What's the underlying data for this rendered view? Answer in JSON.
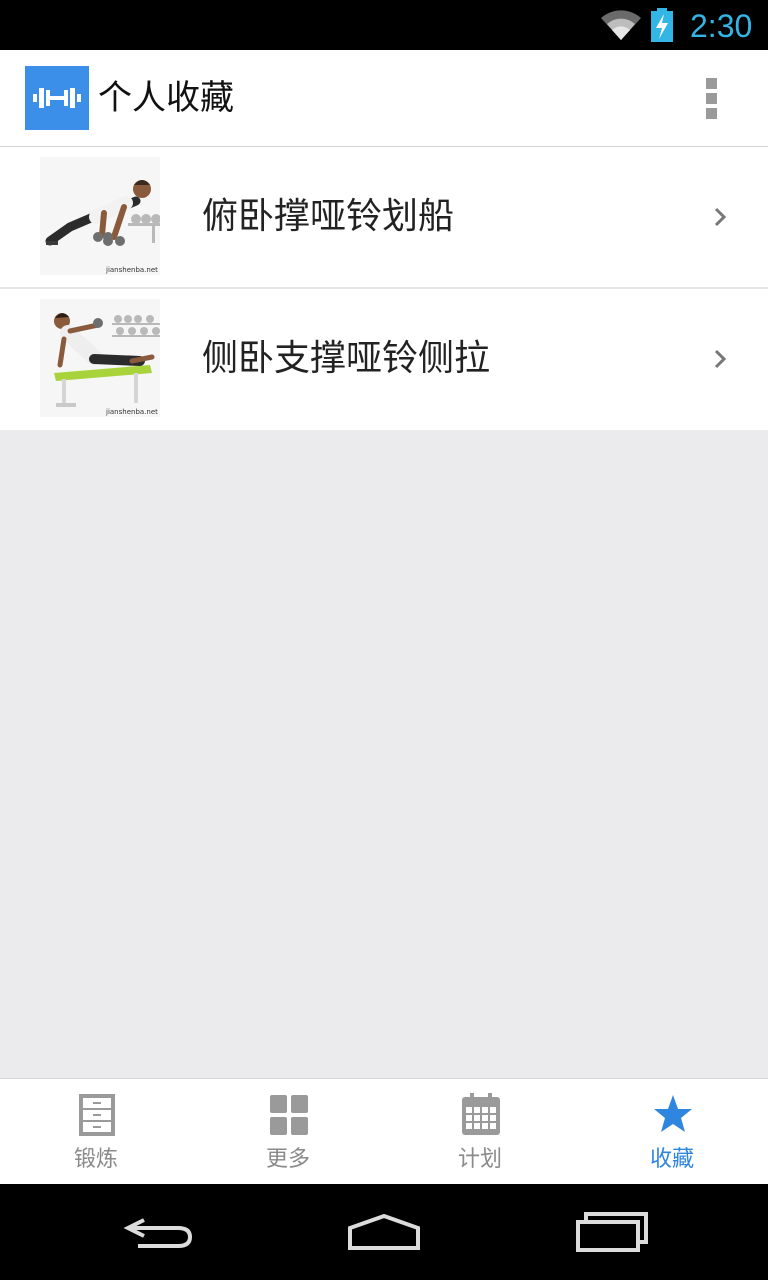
{
  "status_bar": {
    "time": "2:30",
    "icons": [
      "wifi-icon",
      "battery-charging-icon"
    ],
    "time_color": "#33b5e5"
  },
  "action_bar": {
    "title": "个人收藏",
    "app_icon": "dumbbell-icon",
    "app_icon_color": "#3b8fe8",
    "menu_icon": "overflow-menu-icon"
  },
  "favorites": {
    "items": [
      {
        "label": "俯卧撑哑铃划船",
        "thumbnail_caption": "jianshenba.net",
        "icon": "chevron-right-icon"
      },
      {
        "label": "侧卧支撑哑铃侧拉",
        "thumbnail_caption": "jianshenba.net",
        "icon": "chevron-right-icon"
      }
    ]
  },
  "bottom_nav": {
    "active_color": "#2e86de",
    "tabs": [
      {
        "label": "锻炼",
        "icon": "cabinet-icon",
        "active": false
      },
      {
        "label": "更多",
        "icon": "grid-icon",
        "active": false
      },
      {
        "label": "计划",
        "icon": "calendar-icon",
        "active": false
      },
      {
        "label": "收藏",
        "icon": "star-icon",
        "active": true
      }
    ]
  },
  "system_nav": {
    "buttons": [
      "back-icon",
      "home-icon",
      "recents-icon"
    ]
  }
}
